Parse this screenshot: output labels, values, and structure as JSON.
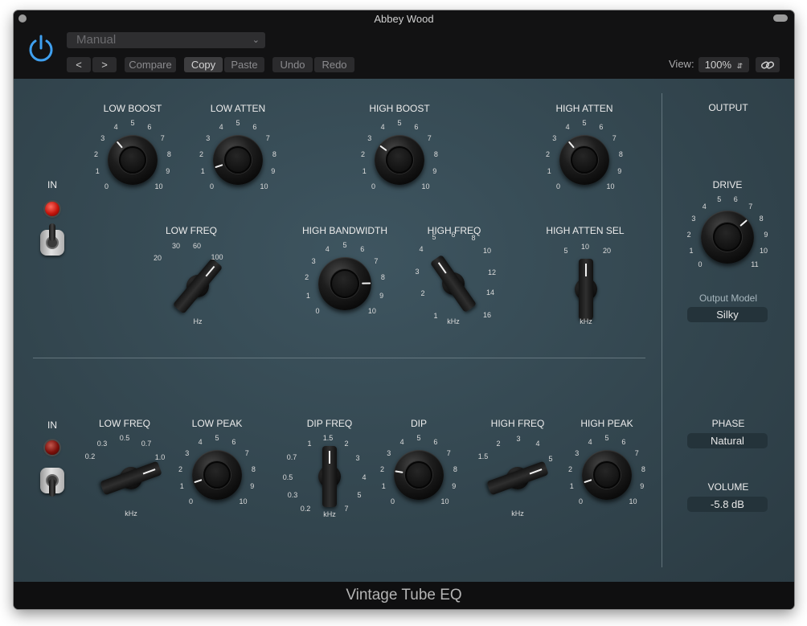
{
  "window": {
    "title": "Abbey Wood",
    "footer": "Vintage Tube EQ"
  },
  "toolbar": {
    "preset": "Manual",
    "prev": "<",
    "next": ">",
    "compare": "Compare",
    "copy": "Copy",
    "paste": "Paste",
    "undo": "Undo",
    "redo": "Redo",
    "view_label": "View:",
    "zoom": "100%"
  },
  "upper": {
    "in_label": "IN",
    "low_boost": {
      "label": "LOW BOOST",
      "value": 3.5
    },
    "low_atten": {
      "label": "LOW ATTEN",
      "value": 1
    },
    "high_boost": {
      "label": "HIGH BOOST",
      "value": 3
    },
    "high_atten": {
      "label": "HIGH ATTEN",
      "value": 3.5
    },
    "low_freq": {
      "label": "LOW FREQ",
      "unit": "Hz",
      "options": [
        "20",
        "30",
        "60",
        "100"
      ],
      "value": "100"
    },
    "high_bandwidth": {
      "label": "HIGH BANDWIDTH",
      "value": 8.3
    },
    "high_freq": {
      "label": "HIGH FREQ",
      "unit": "kHz",
      "options": [
        "1",
        "2",
        "3",
        "4",
        "5",
        "6",
        "8",
        "10",
        "12",
        "14",
        "16"
      ],
      "value": "5"
    },
    "high_atten_sel": {
      "label": "HIGH ATTEN SEL",
      "unit": "kHz",
      "options": [
        "5",
        "10",
        "20"
      ],
      "value": "10"
    }
  },
  "lower": {
    "in_label": "IN",
    "low_freq": {
      "label": "LOW FREQ",
      "unit": "kHz",
      "options": [
        "0.2",
        "0.3",
        "0.5",
        "0.7",
        "1.0"
      ],
      "value": "1.0"
    },
    "low_peak": {
      "label": "LOW PEAK",
      "value": 1
    },
    "dip_freq": {
      "label": "DIP FREQ",
      "unit": "kHz",
      "options": [
        "0.2",
        "0.3",
        "0.5",
        "0.7",
        "1",
        "1.5",
        "2",
        "3",
        "4",
        "5",
        "7"
      ],
      "value": "1.5"
    },
    "dip": {
      "label": "DIP",
      "value": 2
    },
    "high_freq": {
      "label": "HIGH FREQ",
      "unit": "kHz",
      "options": [
        "1.5",
        "2",
        "3",
        "4",
        "5"
      ],
      "value": "5"
    },
    "high_peak": {
      "label": "HIGH PEAK",
      "value": 1
    }
  },
  "output": {
    "section_label": "OUTPUT",
    "drive": {
      "label": "DRIVE",
      "value": 7.5
    },
    "output_model_label": "Output Model",
    "output_model": "Silky",
    "phase_label": "PHASE",
    "phase": "Natural",
    "volume_label": "VOLUME",
    "volume": "-5.8 dB"
  },
  "knob_scale": [
    "0",
    "1",
    "2",
    "3",
    "4",
    "5",
    "6",
    "7",
    "8",
    "9",
    "10"
  ],
  "drive_scale": [
    "0",
    "1",
    "2",
    "3",
    "4",
    "5",
    "6",
    "7",
    "8",
    "9",
    "10",
    "11"
  ]
}
